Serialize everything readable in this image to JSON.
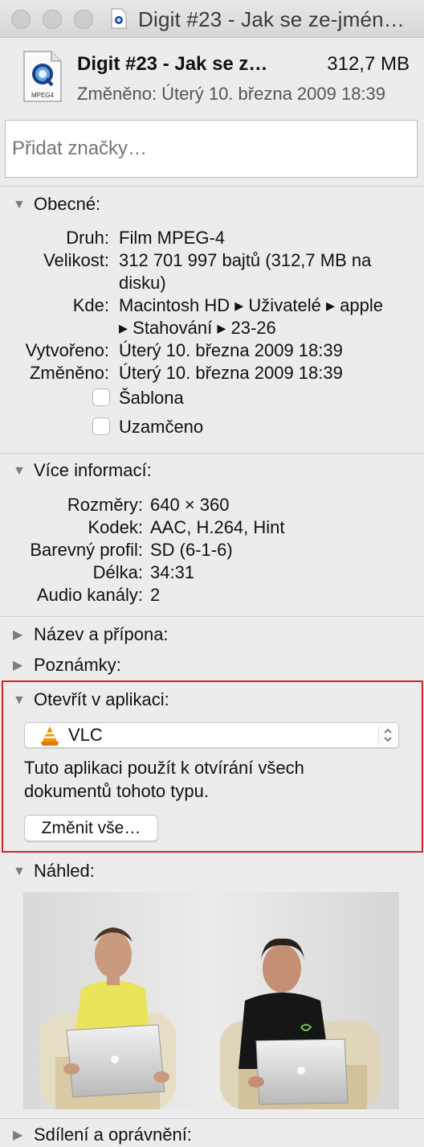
{
  "window": {
    "title": "Digit #23 - Jak se ze-jmén…"
  },
  "header": {
    "name": "Digit #23 - Jak se z…",
    "size": "312,7 MB",
    "modified": "Změněno: Úterý 10. března 2009 18:39",
    "icon_label": "MPEG4"
  },
  "tags": {
    "placeholder": "Přidat značky…"
  },
  "general": {
    "title": "Obecné:",
    "rows": [
      {
        "label": "Druh:",
        "value": "Film MPEG-4"
      },
      {
        "label": "Velikost:",
        "value": "312 701 997 bajtů (312,7 MB na",
        "value2": "disku)"
      },
      {
        "label": "Kde:",
        "value": "Macintosh HD ▸ Uživatelé ▸ apple",
        "value2": "▸ Stahování ▸ 23-26"
      },
      {
        "label": "Vytvořeno:",
        "value": "Úterý 10. března 2009 18:39"
      },
      {
        "label": "Změněno:",
        "value": "Úterý 10. března 2009 18:39"
      }
    ],
    "stationery_label": "Šablona",
    "locked_label": "Uzamčeno"
  },
  "more_info": {
    "title": "Více informací:",
    "rows": [
      {
        "label": "Rozměry:",
        "value": "640 × 360"
      },
      {
        "label": "Kodek:",
        "value": "AAC, H.264, Hint"
      },
      {
        "label": "Barevný profil:",
        "value": "SD (6-1-6)"
      },
      {
        "label": "Délka:",
        "value": "34:31"
      },
      {
        "label": "Audio kanály:",
        "value": "2"
      }
    ]
  },
  "name_ext": {
    "title": "Název a přípona:"
  },
  "comments": {
    "title": "Poznámky:"
  },
  "open_with": {
    "title": "Otevřít v aplikaci:",
    "app": "VLC",
    "description": "Tuto aplikaci použít k otvírání všech dokumentů tohoto typu.",
    "button": "Změnit vše…"
  },
  "preview": {
    "title": "Náhled:"
  },
  "sharing": {
    "title": "Sdílení a oprávnění:"
  },
  "colors": {
    "highlight_frame": "#d32424"
  }
}
